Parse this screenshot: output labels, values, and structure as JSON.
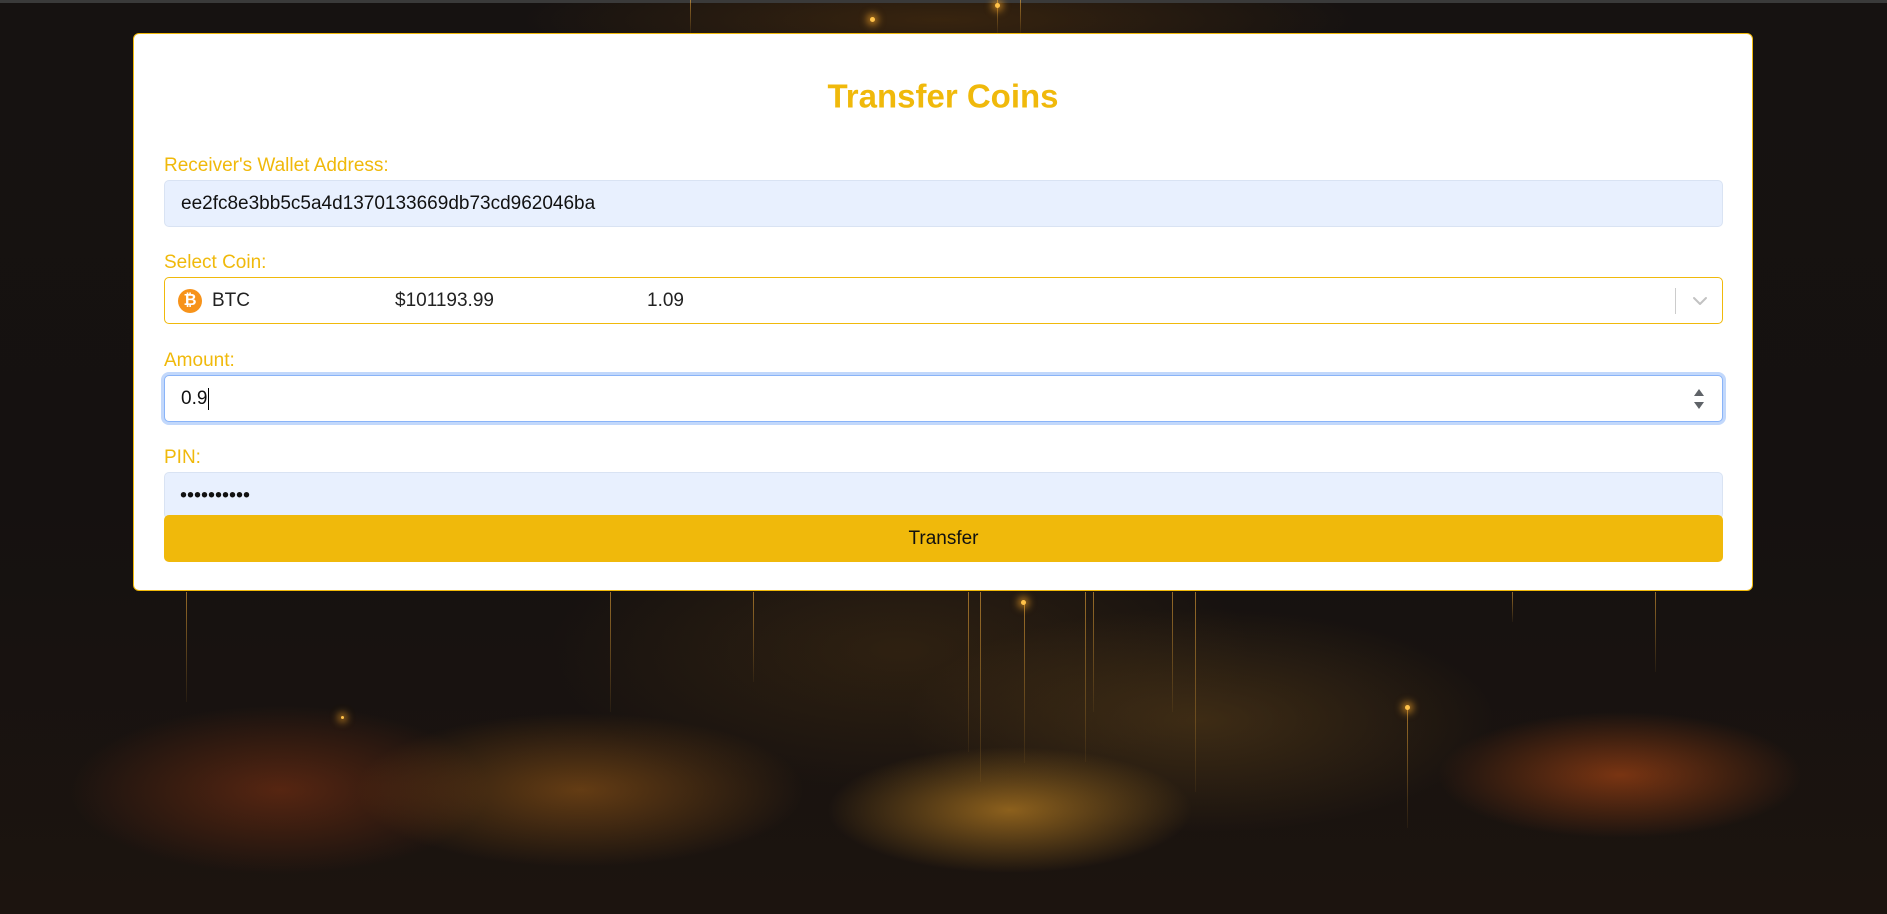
{
  "form": {
    "title": "Transfer Coins",
    "receiver_label": "Receiver's Wallet Address:",
    "receiver_value": "ee2fc8e3bb5c5a4d1370133669db73cd962046ba",
    "coin_label": "Select Coin:",
    "coin_selected": {
      "icon": "bitcoin-icon",
      "icon_glyph": "₿",
      "symbol": "BTC",
      "price": "$101193.99",
      "balance": "1.09"
    },
    "amount_label": "Amount:",
    "amount_value": "0.9",
    "pin_label": "PIN:",
    "pin_masked": "••••••••••",
    "submit_label": "Transfer"
  },
  "colors": {
    "accent": "#f0b90b",
    "autofill_bg": "#e8f0fe",
    "focus_ring": "#8ab4f8",
    "bitcoin": "#f7931a"
  }
}
